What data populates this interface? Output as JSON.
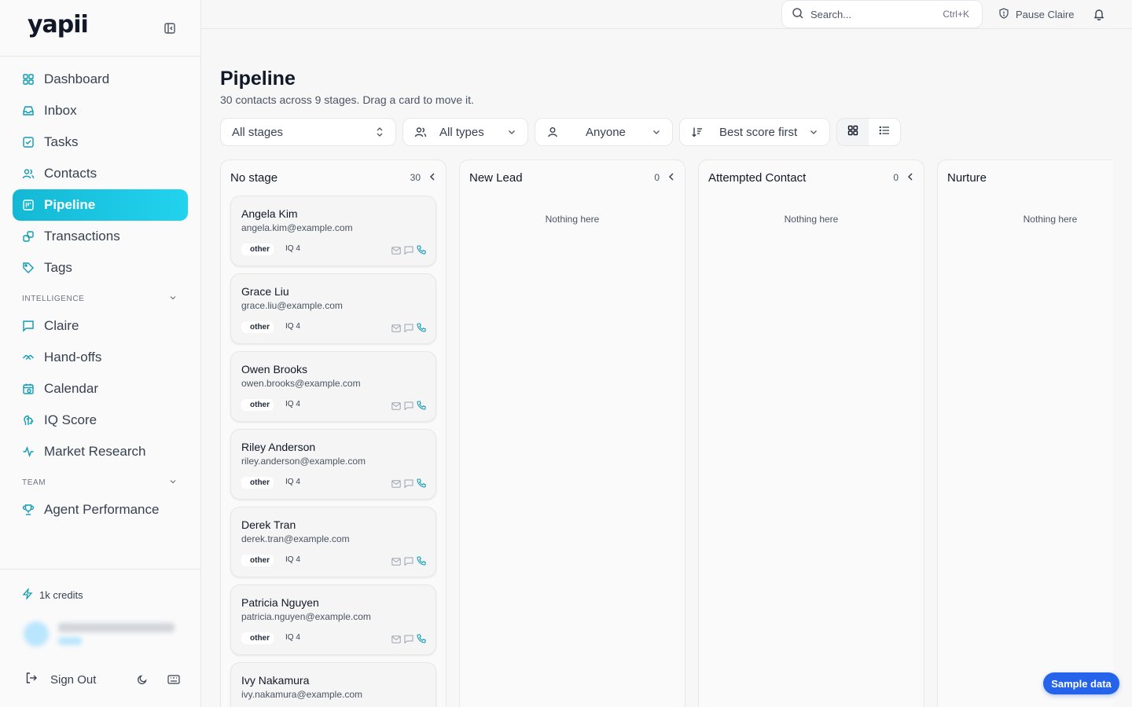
{
  "brand": {
    "logo": "yapii"
  },
  "nav": {
    "main": [
      {
        "label": "Dashboard",
        "icon": "dashboard-icon"
      },
      {
        "label": "Inbox",
        "icon": "inbox-icon"
      },
      {
        "label": "Tasks",
        "icon": "tasks-icon"
      },
      {
        "label": "Contacts",
        "icon": "contacts-icon"
      },
      {
        "label": "Pipeline",
        "icon": "pipeline-icon",
        "active": true
      },
      {
        "label": "Transactions",
        "icon": "transactions-icon"
      },
      {
        "label": "Tags",
        "icon": "tag-icon"
      }
    ],
    "intelligence_label": "INTELLIGENCE",
    "intelligence": [
      {
        "label": "Claire",
        "icon": "chat-icon"
      },
      {
        "label": "Hand-offs",
        "icon": "handshake-icon"
      },
      {
        "label": "Calendar",
        "icon": "calendar-icon"
      },
      {
        "label": "IQ Score",
        "icon": "brain-icon"
      },
      {
        "label": "Market Research",
        "icon": "activity-icon"
      }
    ],
    "team_label": "TEAM",
    "team": [
      {
        "label": "Agent Performance",
        "icon": "trophy-icon"
      }
    ]
  },
  "sidebar_bottom": {
    "credits": "1k credits",
    "sign_out": "Sign Out"
  },
  "topbar": {
    "search_placeholder": "Search...",
    "search_shortcut": "Ctrl+K",
    "pause": "Pause Claire"
  },
  "page": {
    "title": "Pipeline",
    "subtitle": "30 contacts across 9 stages. Drag a card to move it."
  },
  "filters": {
    "stages": "All stages",
    "types": "All types",
    "assignee": "Anyone",
    "sort": "Best score first"
  },
  "columns": [
    {
      "name": "No stage",
      "count": "30"
    },
    {
      "name": "New Lead",
      "count": "0",
      "empty": "Nothing here"
    },
    {
      "name": "Attempted Contact",
      "count": "0",
      "empty": "Nothing here"
    },
    {
      "name": "Nurture",
      "count": "",
      "empty": "Nothing here"
    }
  ],
  "cards": [
    {
      "name": "Angela Kim",
      "email": "angela.kim@example.com",
      "tag": "other",
      "iq": "IQ 4"
    },
    {
      "name": "Grace Liu",
      "email": "grace.liu@example.com",
      "tag": "other",
      "iq": "IQ 4"
    },
    {
      "name": "Owen Brooks",
      "email": "owen.brooks@example.com",
      "tag": "other",
      "iq": "IQ 4"
    },
    {
      "name": "Riley Anderson",
      "email": "riley.anderson@example.com",
      "tag": "other",
      "iq": "IQ 4"
    },
    {
      "name": "Derek Tran",
      "email": "derek.tran@example.com",
      "tag": "other",
      "iq": "IQ 4"
    },
    {
      "name": "Patricia Nguyen",
      "email": "patricia.nguyen@example.com",
      "tag": "other",
      "iq": "IQ 4"
    },
    {
      "name": "Ivy Nakamura",
      "email": "ivy.nakamura@example.com",
      "tag": "",
      "iq": ""
    }
  ],
  "sample_button": "Sample data",
  "colors": {
    "accent": "#22d3ee",
    "primary_button": "#2563eb",
    "icon_teal": "#0e9bb5"
  }
}
